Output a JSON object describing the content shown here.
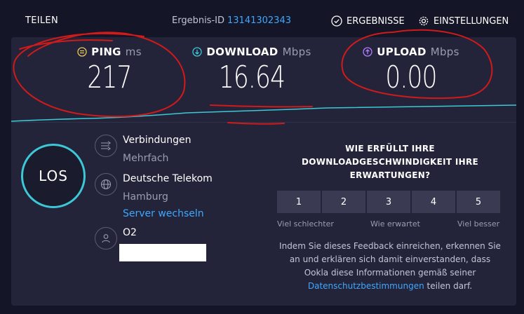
{
  "header": {
    "share_label": "TEILEN",
    "result_label": "Ergebnis-ID",
    "result_id": "13141302343",
    "results_label": "ERGEBNISSE",
    "settings_label": "EINSTELLUNGEN"
  },
  "metrics": {
    "ping": {
      "label": "PING",
      "unit": "ms",
      "value": "217"
    },
    "download": {
      "label": "DOWNLOAD",
      "unit": "Mbps",
      "value": "16.64"
    },
    "upload": {
      "label": "UPLOAD",
      "unit": "Mbps",
      "value": "0.00"
    }
  },
  "go_label": "LOS",
  "connections": {
    "label": "Verbindungen",
    "value": "Mehrfach"
  },
  "server": {
    "name": "Deutsche Telekom",
    "city": "Hamburg",
    "change_label": "Server wechseln"
  },
  "provider": {
    "name": "O2"
  },
  "feedback": {
    "question": "WIE ERFÜLLT IHRE DOWNLOADGESCHWINDIGKEIT IHRE ERWARTUNGEN?",
    "scale": [
      "1",
      "2",
      "3",
      "4",
      "5"
    ],
    "low_label": "Viel schlechter",
    "mid_label": "Wie erwartet",
    "high_label": "Viel besser",
    "note_text": "Indem Sie dieses Feedback einreichen, erkennen Sie an und erklären sich damit einverstanden, dass Ookla diese Informationen gemäß seiner",
    "note_link": "Datenschutzbestimmungen",
    "note_tail": "teilen darf."
  },
  "colors": {
    "accent_blue": "#3ea8ff",
    "ping_icon": "#e8c95a",
    "download_icon": "#3cc8d6",
    "upload_icon": "#b07cff",
    "annotation_red": "#d11a1a"
  }
}
